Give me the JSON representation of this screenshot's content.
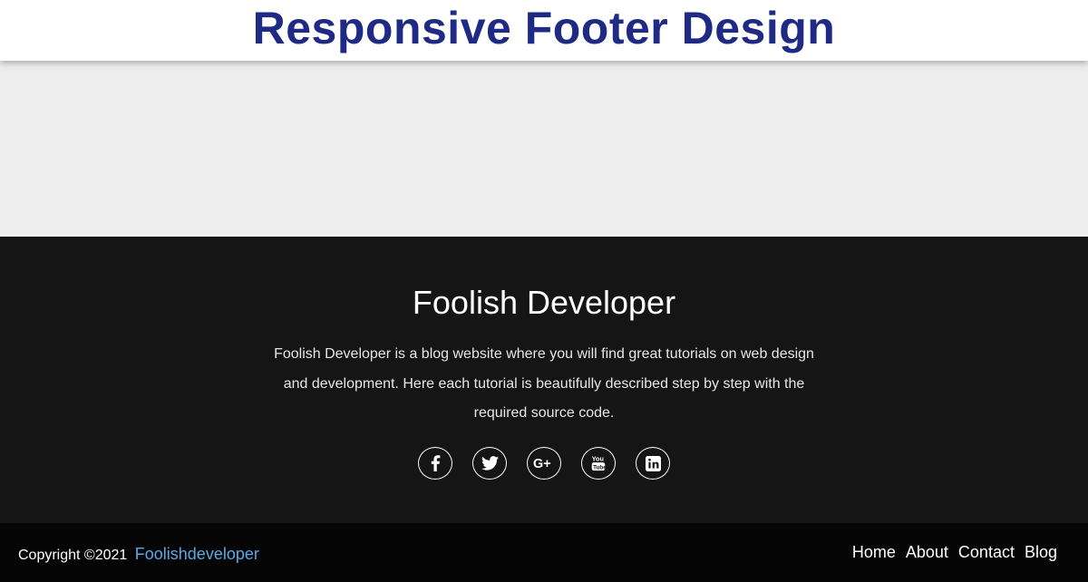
{
  "banner": {
    "title": "Responsive Footer Design"
  },
  "footer": {
    "title": "Foolish Developer",
    "description": "Foolish Developer is a blog website where you will find great tutorials on web design and development. Here each tutorial is beautifully described step by step with the required source code.",
    "socials": [
      {
        "icon": "facebook-icon"
      },
      {
        "icon": "twitter-icon"
      },
      {
        "icon": "google-plus-icon"
      },
      {
        "icon": "youtube-icon"
      },
      {
        "icon": "linkedin-icon"
      }
    ]
  },
  "bottom_bar": {
    "copyright": "Copyright ©2021",
    "brand_link": "Foolishdeveloper",
    "nav": [
      "Home",
      "About",
      "Contact",
      "Blog"
    ]
  },
  "colors": {
    "banner_title": "#1e2a84",
    "footer_bg": "#151515",
    "bottom_bg": "#050505",
    "link_accent": "#5aa9e6",
    "page_bg": "#ededed"
  }
}
